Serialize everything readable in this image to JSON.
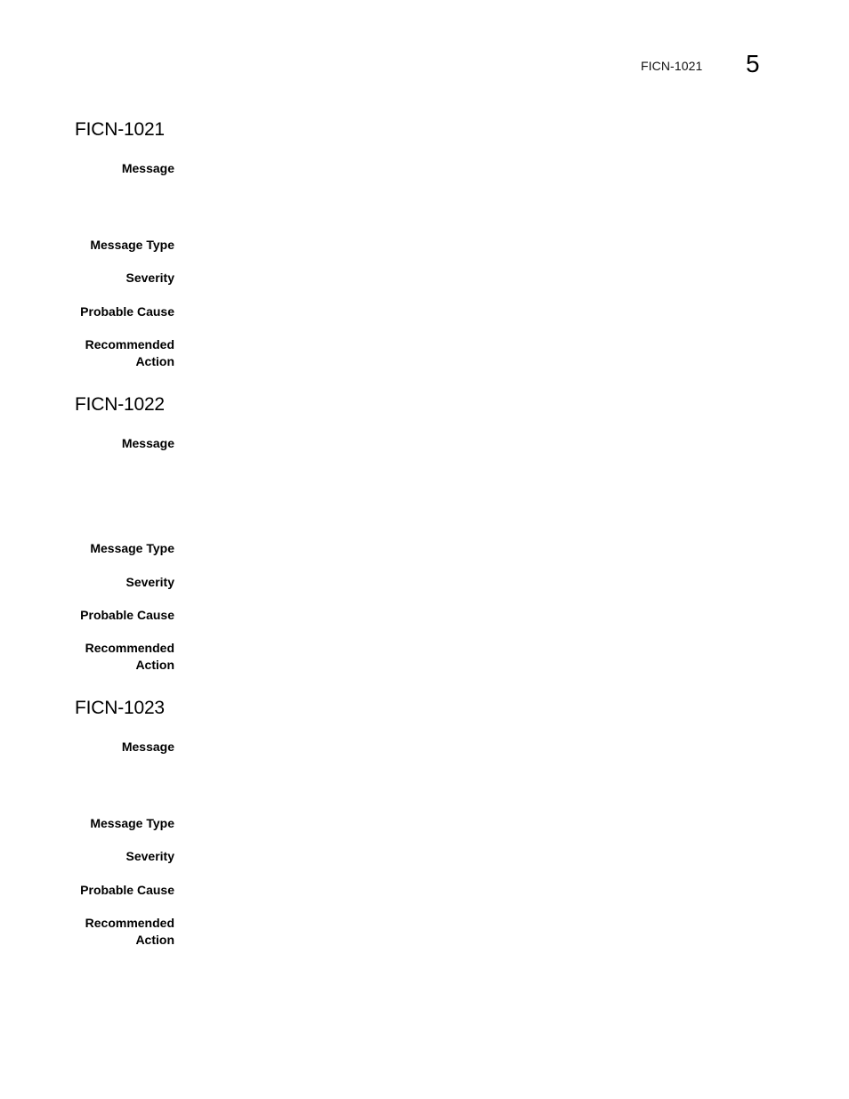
{
  "header": {
    "running_title": "FICN-1021",
    "chapter_number": "5"
  },
  "sections": [
    {
      "id": "FICN-1021",
      "title": "FICN-1021",
      "fields": {
        "message": {
          "label": "Message",
          "value": ""
        },
        "message_type": {
          "label": "Message Type",
          "value": ""
        },
        "severity": {
          "label": "Severity",
          "value": ""
        },
        "probable_cause": {
          "label": "Probable Cause",
          "value": ""
        },
        "recommended_action": {
          "label_line1": "Recommended",
          "label_line2": "Action",
          "value": ""
        }
      }
    },
    {
      "id": "FICN-1022",
      "title": "FICN-1022",
      "fields": {
        "message": {
          "label": "Message",
          "value": ""
        },
        "message_type": {
          "label": "Message Type",
          "value": ""
        },
        "severity": {
          "label": "Severity",
          "value": ""
        },
        "probable_cause": {
          "label": "Probable Cause",
          "value": ""
        },
        "recommended_action": {
          "label_line1": "Recommended",
          "label_line2": "Action",
          "value": ""
        }
      }
    },
    {
      "id": "FICN-1023",
      "title": "FICN-1023",
      "fields": {
        "message": {
          "label": "Message",
          "value": ""
        },
        "message_type": {
          "label": "Message Type",
          "value": ""
        },
        "severity": {
          "label": "Severity",
          "value": ""
        },
        "probable_cause": {
          "label": "Probable Cause",
          "value": ""
        },
        "recommended_action": {
          "label_line1": "Recommended",
          "label_line2": "Action",
          "value": ""
        }
      }
    }
  ]
}
